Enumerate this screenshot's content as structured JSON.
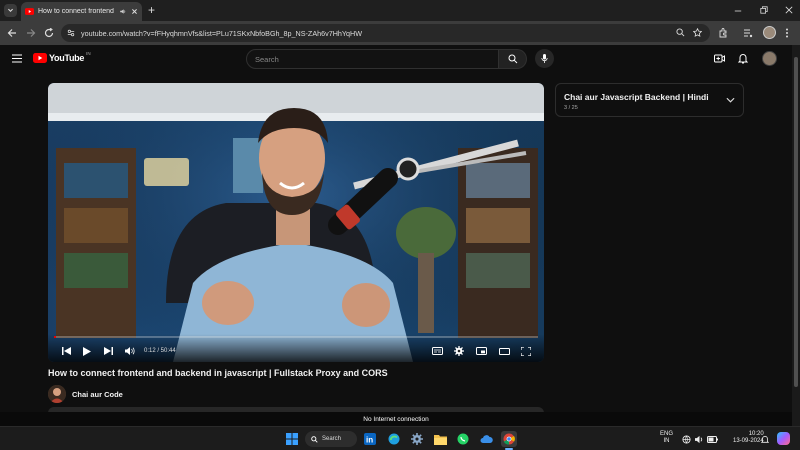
{
  "browser": {
    "tab_title": "How to connect frontend a",
    "url": "youtube.com/watch?v=fFHyqhmnVfs&list=PLu71SKxNbfoBGh_8p_NS-ZAh6v7HhYqHW",
    "new_tab_label": "+"
  },
  "youtube": {
    "logo_text": "YouTube",
    "region": "IN",
    "search_placeholder": "Search"
  },
  "player": {
    "time_current": "0:12",
    "time_total": "50:44",
    "time_text": "0:12 / 50:44",
    "progress_fraction": 0.004
  },
  "playlist": {
    "title": "Chai aur Javascript Backend | Hindi",
    "count": "3 / 25"
  },
  "video": {
    "title": "How to connect frontend and backend in javascript | Fullstack Proxy and CORS",
    "channel": "Chai aur Code"
  },
  "status": {
    "offline_message": "No Internet connection"
  },
  "taskbar": {
    "search_label": "Search",
    "lang_line1": "ENG",
    "lang_line2": "IN",
    "time": "10:20",
    "date": "13-09-2024"
  },
  "colors": {
    "accent": "#ff0000",
    "background": "#0f0f0f",
    "chrome_toolbar": "#3c3c3c"
  }
}
